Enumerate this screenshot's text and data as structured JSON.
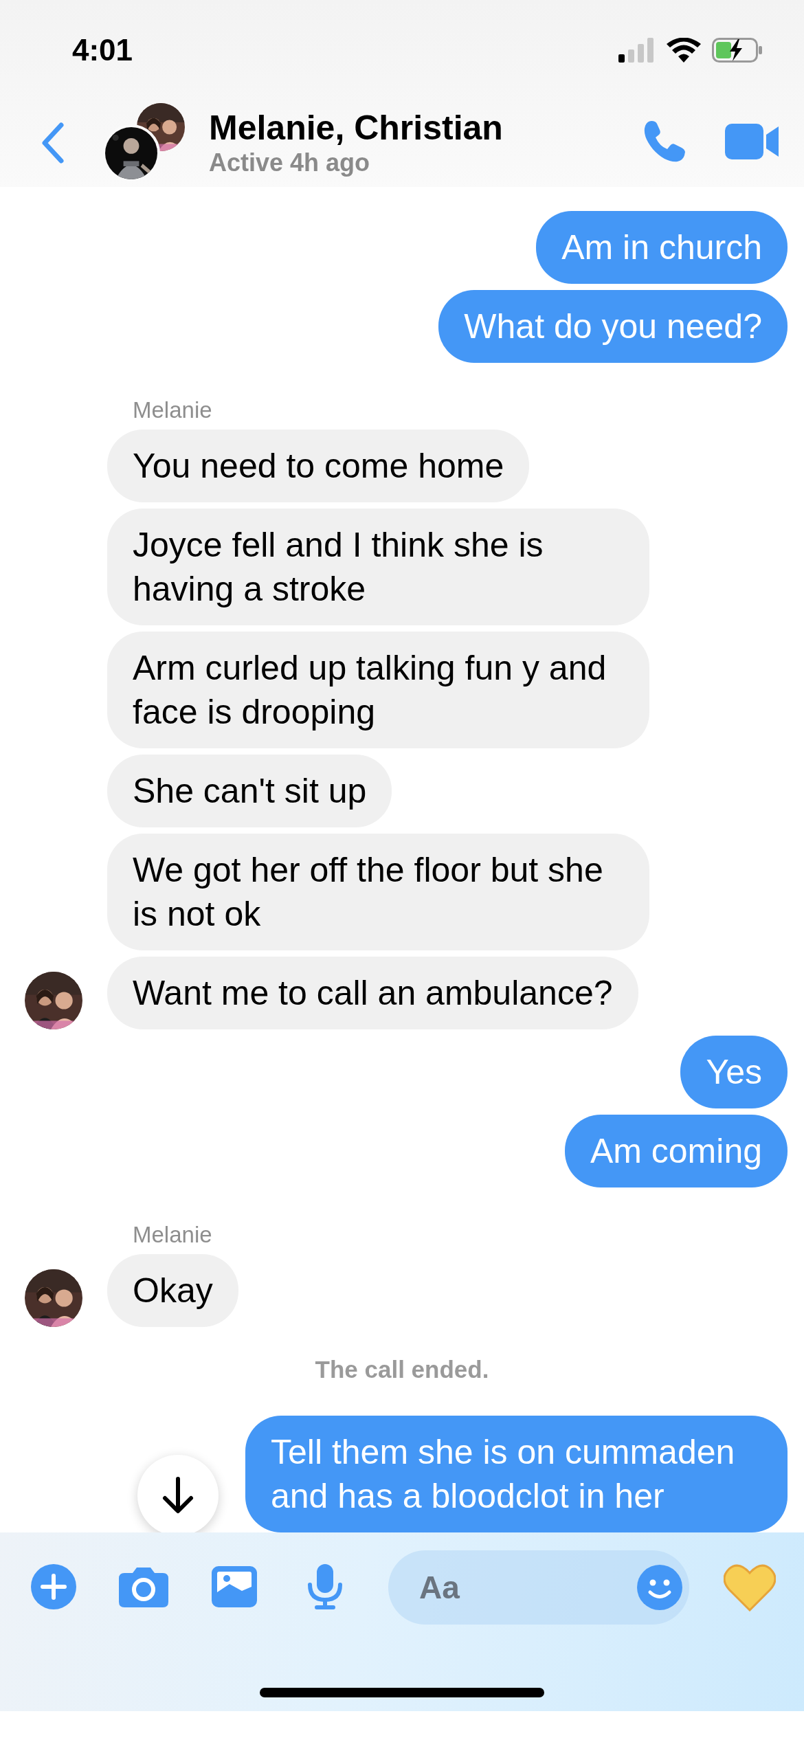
{
  "status_bar": {
    "time": "4:01"
  },
  "header": {
    "title": "Melanie, Christian",
    "subtitle": "Active 4h ago"
  },
  "messages": [
    {
      "kind": "outgoing",
      "text": "Am in church"
    },
    {
      "kind": "outgoing",
      "text": "What do you need?"
    },
    {
      "kind": "sender",
      "text": "Melanie"
    },
    {
      "kind": "incoming",
      "text": "You need to come home",
      "avatar": false
    },
    {
      "kind": "incoming",
      "text": "Joyce fell and I think she is having a stroke",
      "avatar": false
    },
    {
      "kind": "incoming",
      "text": "Arm curled up talking fun y and face is drooping",
      "avatar": false
    },
    {
      "kind": "incoming",
      "text": "She can't sit up",
      "avatar": false
    },
    {
      "kind": "incoming",
      "text": "We got her off the floor but she is not ok",
      "avatar": false
    },
    {
      "kind": "incoming",
      "text": "Want me to call an ambulance?",
      "avatar": true
    },
    {
      "kind": "outgoing",
      "text": "Yes"
    },
    {
      "kind": "outgoing",
      "text": "Am coming"
    },
    {
      "kind": "sender",
      "text": "Melanie"
    },
    {
      "kind": "incoming",
      "text": "Okay",
      "avatar": true
    },
    {
      "kind": "system",
      "text": "The call ended."
    },
    {
      "kind": "outgoing",
      "text": "Tell them she is on cummaden and has a bloodclot in her"
    }
  ],
  "composer": {
    "placeholder": "Aa"
  }
}
